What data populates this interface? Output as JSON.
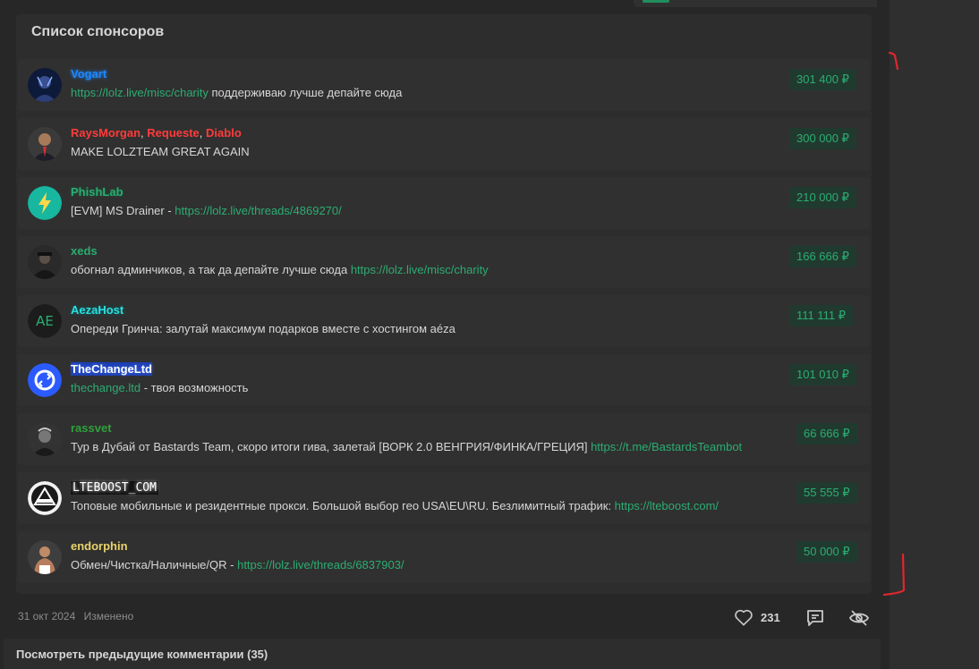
{
  "card": {
    "title": "Список спонсоров"
  },
  "sponsors": [
    {
      "names": [
        {
          "text": "Vogart",
          "color": "#1e88ff"
        }
      ],
      "desc": [
        {
          "text": "https://lolz.live/misc/charity",
          "link": true
        },
        {
          "text": " поддерживаю лучше депайте сюда",
          "link": false
        }
      ],
      "amount": "301 400 ₽",
      "avatar_icon": "vogart-avatar"
    },
    {
      "names": [
        {
          "text": "RaysMorgan",
          "color": "#ff3b3b"
        },
        {
          "text": "Requeste",
          "color": "#ff3b3b"
        },
        {
          "text": "Diablo",
          "color": "#ff3b3b"
        }
      ],
      "desc": [
        {
          "text": "MAKE LOLZTEAM GREAT AGAIN",
          "link": false
        }
      ],
      "amount": "300 000 ₽",
      "avatar_icon": "raysmorgan-avatar"
    },
    {
      "names": [
        {
          "text": "PhishLab",
          "color": "#2bad72"
        }
      ],
      "desc": [
        {
          "text": "[EVM] MS Drainer - ",
          "link": false
        },
        {
          "text": "https://lolz.live/threads/4869270/",
          "link": true
        }
      ],
      "amount": "210 000 ₽",
      "avatar_icon": "lightning-icon"
    },
    {
      "names": [
        {
          "text": "xeds",
          "color": "#2bad72"
        }
      ],
      "desc": [
        {
          "text": "обогнал админчиков, а так да депайте лучше сюда ",
          "link": false
        },
        {
          "text": "https://lolz.live/misc/charity",
          "link": true
        }
      ],
      "amount": "166 666 ₽",
      "avatar_icon": "xeds-avatar"
    },
    {
      "names": [
        {
          "text": "AezaHost",
          "color": "#29e0e0"
        }
      ],
      "desc": [
        {
          "text": "Опереди Гринча: залутай максимум подарков вместе с хостингом aéza",
          "link": false
        }
      ],
      "amount": "111 111 ₽",
      "avatar_icon": "ae-logo-icon",
      "avatar_text": "AE"
    },
    {
      "names": [
        {
          "text": "TheChangeLtd",
          "color": "#ffffff"
        }
      ],
      "desc": [
        {
          "text": "thechange.ltd",
          "link": true
        },
        {
          "text": " - твоя возможность",
          "link": false
        }
      ],
      "amount": "101 010 ₽",
      "avatar_icon": "thechange-logo-icon"
    },
    {
      "names": [
        {
          "text": "rassvet",
          "color": "#2ea13a"
        }
      ],
      "desc": [
        {
          "text": "Тур в Дубай от Bastards Team, скоро итоги гива, залетай [ВОРК 2.0 ВЕНГРИЯ/ФИНКА/ГРЕЦИЯ] ",
          "link": false
        },
        {
          "text": "https://t.me/BastardsTeambot",
          "link": true
        }
      ],
      "amount": "66 666 ₽",
      "avatar_icon": "rassvet-avatar"
    },
    {
      "names": [
        {
          "text": "LTEBOOST_COM",
          "color": "#ffffff"
        }
      ],
      "desc": [
        {
          "text": "Топовые мобильные и резидентные прокси. Большой выбор гео USA\\EU\\RU. Безлимитный трафик: ",
          "link": false
        },
        {
          "text": "https://lteboost.com/",
          "link": true
        }
      ],
      "amount": "55 555 ₽",
      "avatar_icon": "lteboost-logo-icon"
    },
    {
      "names": [
        {
          "text": "endorphin",
          "color": "#e8d36a"
        }
      ],
      "desc": [
        {
          "text": "Обмен/Чистка/Наличные/QR - ",
          "link": false
        },
        {
          "text": "https://lolz.live/threads/6837903/",
          "link": true
        }
      ],
      "amount": "50 000 ₽",
      "avatar_icon": "endorphin-avatar"
    }
  ],
  "footer": {
    "date": "31 окт 2024",
    "edited": "Изменено",
    "likes": "231"
  },
  "prev_comments": "Посмотреть предыдущие комментарии (35)",
  "colors": {
    "accent": "#2bad72",
    "annotation": "#e0262f"
  }
}
